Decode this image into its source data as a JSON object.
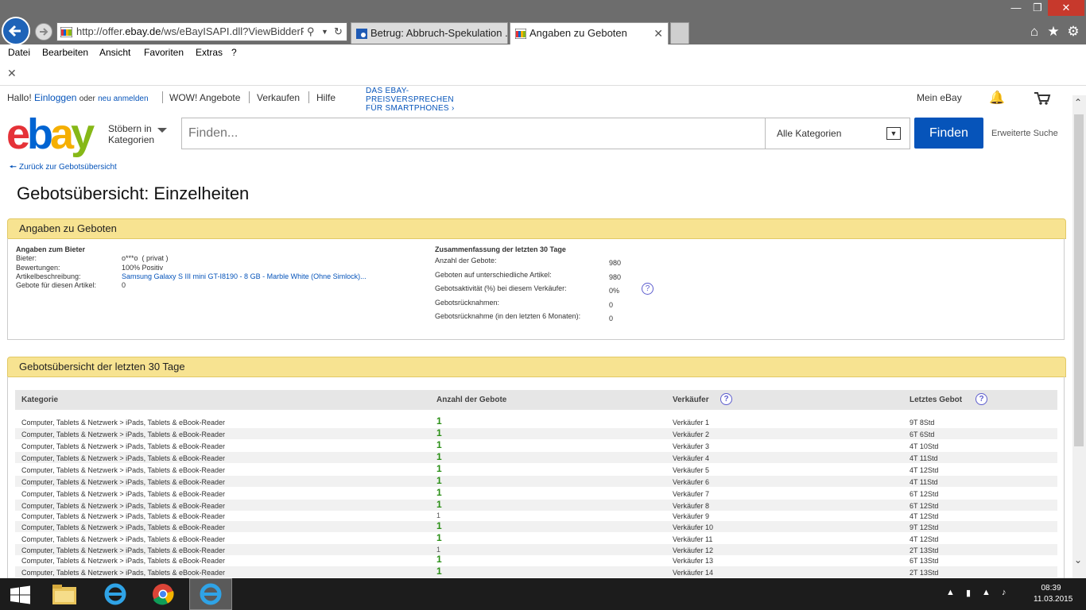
{
  "browser": {
    "url_prefix": "http://offer.",
    "url_domain": "ebay.de",
    "url_suffix": "/ws/eBayISAPI.dll?ViewBidderProfi",
    "tabs": [
      {
        "label": "Betrug: Abbruch-Spekulation ..."
      },
      {
        "label": "Angaben zu Geboten"
      }
    ],
    "menu": [
      "Datei",
      "Bearbeiten",
      "Ansicht",
      "Favoriten",
      "Extras",
      "?"
    ]
  },
  "ebay_header": {
    "hello": "Hallo!",
    "login": "Einloggen",
    "or": "oder",
    "register": "neu anmelden",
    "links": [
      "WOW! Angebote",
      "Verkaufen",
      "Hilfe"
    ],
    "promo_line1": "DAS EBAY-",
    "promo_line2": "PREISVERSPRECHEN",
    "promo_line3": "FÜR SMARTPHONES",
    "my_ebay": "Mein eBay"
  },
  "search": {
    "logo_e": "e",
    "logo_b": "b",
    "logo_a": "a",
    "logo_y": "y",
    "browse_line1": "Stöbern in",
    "browse_line2": "Kategorien",
    "placeholder": "Finden...",
    "category": "Alle Kategorien",
    "button": "Finden",
    "advanced": "Erweiterte Suche"
  },
  "page": {
    "back_link": "Zurück zur Gebotsübersicht",
    "title": "Gebotsübersicht: Einzelheiten"
  },
  "bid_info": {
    "header": "Angaben zu Geboten",
    "bidder_heading": "Angaben zum Bieter",
    "bidder_label": "Bieter:",
    "bidder_value": "o***o  ( privat )",
    "ratings_label": "Bewertungen:",
    "ratings_value": "100% Positiv",
    "item_label": "Artikelbeschreibung:",
    "item_value": "Samsung Galaxy S III mini GT-I8190 - 8 GB - Marble White (Ohne Simlock)...",
    "bids_item_label": "Gebote für diesen Artikel:",
    "bids_item_value": "0",
    "summary_heading": "Zusammenfassung der letzten 30 Tage",
    "summary": [
      {
        "label": "Anzahl der Gebote:",
        "value": "980"
      },
      {
        "label": "Geboten auf unterschiedliche Artikel:",
        "value": "980"
      },
      {
        "label": "Gebotsaktivität (%) bei diesem Verkäufer:",
        "value": "0%"
      },
      {
        "label": "Gebotsrücknahmen:",
        "value": "0"
      },
      {
        "label": "Gebotsrücknahme (in den letzten 6 Monaten):",
        "value": "0"
      }
    ]
  },
  "bid_overview": {
    "header": "Gebotsübersicht der letzten 30 Tage",
    "columns": [
      "Kategorie",
      "Anzahl der Gebote",
      "Verkäufer",
      "Letztes Gebot"
    ],
    "rows": [
      {
        "category": "Computer, Tablets & Netzwerk > iPads, Tablets & eBook-Reader",
        "count": "1",
        "seller": "Verkäufer 1",
        "last": "9T 8Std"
      },
      {
        "category": "Computer, Tablets & Netzwerk > iPads, Tablets & eBook-Reader",
        "count": "1",
        "seller": "Verkäufer 2",
        "last": "6T 6Std"
      },
      {
        "category": "Computer, Tablets & Netzwerk > iPads, Tablets & eBook-Reader",
        "count": "1",
        "seller": "Verkäufer 3",
        "last": "4T 10Std"
      },
      {
        "category": "Computer, Tablets & Netzwerk > iPads, Tablets & eBook-Reader",
        "count": "1",
        "seller": "Verkäufer 4",
        "last": "4T 11Std"
      },
      {
        "category": "Computer, Tablets & Netzwerk > iPads, Tablets & eBook-Reader",
        "count": "1",
        "seller": "Verkäufer 5",
        "last": "4T 12Std"
      },
      {
        "category": "Computer, Tablets & Netzwerk > iPads, Tablets & eBook-Reader",
        "count": "1",
        "seller": "Verkäufer 6",
        "last": "4T 11Std"
      },
      {
        "category": "Computer, Tablets & Netzwerk > iPads, Tablets & eBook-Reader",
        "count": "1",
        "seller": "Verkäufer 7",
        "last": "6T 12Std"
      },
      {
        "category": "Computer, Tablets & Netzwerk > iPads, Tablets & eBook-Reader",
        "count": "1",
        "seller": "Verkäufer 8",
        "last": "6T 12Std"
      },
      {
        "category": "Computer, Tablets & Netzwerk > iPads, Tablets & eBook-Reader",
        "count": "1",
        "seller": "Verkäufer 9",
        "last": "4T 12Std"
      },
      {
        "category": "Computer, Tablets & Netzwerk > iPads, Tablets & eBook-Reader",
        "count": "1",
        "seller": "Verkäufer 10",
        "last": "9T 12Std"
      },
      {
        "category": "Computer, Tablets & Netzwerk > iPads, Tablets & eBook-Reader",
        "count": "1",
        "seller": "Verkäufer 11",
        "last": "4T 12Std"
      },
      {
        "category": "Computer, Tablets & Netzwerk > iPads, Tablets & eBook-Reader",
        "count": "1",
        "seller": "Verkäufer 12",
        "last": "2T 13Std"
      },
      {
        "category": "Computer, Tablets & Netzwerk > iPads, Tablets & eBook-Reader",
        "count": "1",
        "seller": "Verkäufer 13",
        "last": "6T 13Std"
      },
      {
        "category": "Computer, Tablets & Netzwerk > iPads, Tablets & eBook-Reader",
        "count": "1",
        "seller": "Verkäufer 14",
        "last": "2T 13Std"
      }
    ]
  },
  "taskbar": {
    "time": "08:39",
    "date": "11.03.2015"
  },
  "colors": {
    "ebay_blue": "#0654ba",
    "panel_yellow": "#f7e391",
    "count_green": "#2b8f17"
  }
}
